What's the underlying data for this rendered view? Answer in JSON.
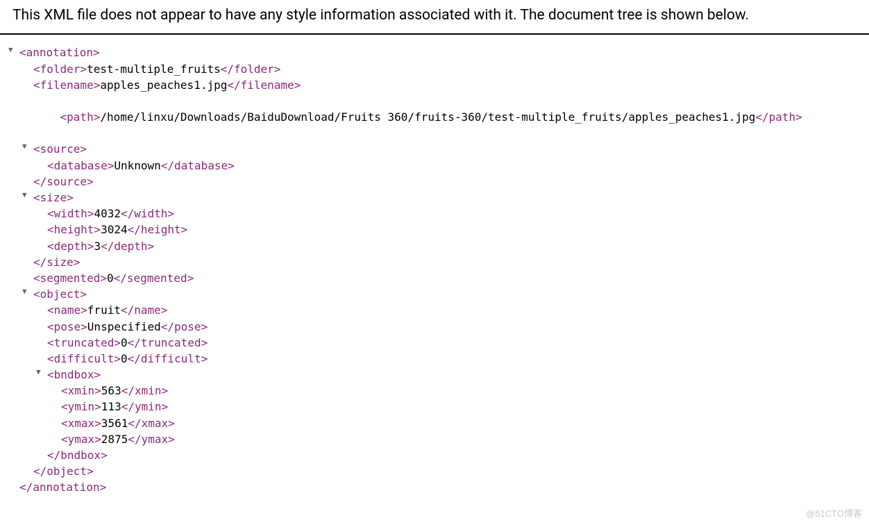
{
  "header": "This XML file does not appear to have any style information associated with it. The document tree is shown below.",
  "toggle_glyph": "▼",
  "tags": {
    "annotation_open": "<annotation>",
    "annotation_close": "</annotation>",
    "folder_open": "<folder>",
    "folder_close": "</folder>",
    "filename_open": "<filename>",
    "filename_close": "</filename>",
    "path_open": "<path>",
    "path_close": "</path>",
    "source_open": "<source>",
    "source_close": "</source>",
    "database_open": "<database>",
    "database_close": "</database>",
    "size_open": "<size>",
    "size_close": "</size>",
    "width_open": "<width>",
    "width_close": "</width>",
    "height_open": "<height>",
    "height_close": "</height>",
    "depth_open": "<depth>",
    "depth_close": "</depth>",
    "segmented_open": "<segmented>",
    "segmented_close": "</segmented>",
    "object_open": "<object>",
    "object_close": "</object>",
    "name_open": "<name>",
    "name_close": "</name>",
    "pose_open": "<pose>",
    "pose_close": "</pose>",
    "truncated_open": "<truncated>",
    "truncated_close": "</truncated>",
    "difficult_open": "<difficult>",
    "difficult_close": "</difficult>",
    "bndbox_open": "<bndbox>",
    "bndbox_close": "</bndbox>",
    "xmin_open": "<xmin>",
    "xmin_close": "</xmin>",
    "ymin_open": "<ymin>",
    "ymin_close": "</ymin>",
    "xmax_open": "<xmax>",
    "xmax_close": "</xmax>",
    "ymax_open": "<ymax>",
    "ymax_close": "</ymax>"
  },
  "values": {
    "folder": "test-multiple_fruits",
    "filename": "apples_peaches1.jpg",
    "path": "/home/linxu/Downloads/BaiduDownload/Fruits 360/fruits-360/test-multiple_fruits/apples_peaches1.jpg",
    "database": "Unknown",
    "width": "4032",
    "height": "3024",
    "depth": "3",
    "segmented": "0",
    "name": "fruit",
    "pose": "Unspecified",
    "truncated": "0",
    "difficult": "0",
    "xmin": "563",
    "ymin": "113",
    "xmax": "3561",
    "ymax": "2875"
  },
  "watermark": "@51CTO博客"
}
